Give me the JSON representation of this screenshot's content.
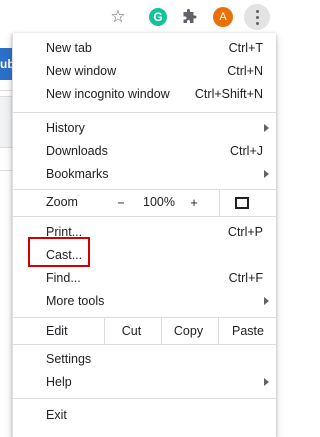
{
  "toolbar": {
    "bookmark_icon": "star-icon",
    "grammarly_letter": "G",
    "extensions_icon": "puzzle-icon",
    "avatar_letter": "A",
    "menu_icon": "kebab-icon"
  },
  "background": {
    "fragment_text": "ubl"
  },
  "menu": {
    "new_tab": {
      "label": "New tab",
      "shortcut": "Ctrl+T"
    },
    "new_window": {
      "label": "New window",
      "shortcut": "Ctrl+N"
    },
    "new_incognito": {
      "label": "New incognito window",
      "shortcut": "Ctrl+Shift+N"
    },
    "history": {
      "label": "History"
    },
    "downloads": {
      "label": "Downloads",
      "shortcut": "Ctrl+J"
    },
    "bookmarks": {
      "label": "Bookmarks"
    },
    "zoom": {
      "label": "Zoom",
      "minus": "−",
      "value": "100%",
      "plus": "+"
    },
    "print": {
      "label": "Print...",
      "shortcut": "Ctrl+P"
    },
    "cast": {
      "label": "Cast..."
    },
    "find": {
      "label": "Find...",
      "shortcut": "Ctrl+F"
    },
    "more_tools": {
      "label": "More tools"
    },
    "edit": {
      "label": "Edit",
      "cut": "Cut",
      "copy": "Copy",
      "paste": "Paste"
    },
    "settings": {
      "label": "Settings"
    },
    "help": {
      "label": "Help"
    },
    "exit": {
      "label": "Exit"
    }
  },
  "colors": {
    "highlight": "#d40000",
    "grammarly": "#15c39a",
    "avatar": "#e8710a"
  }
}
